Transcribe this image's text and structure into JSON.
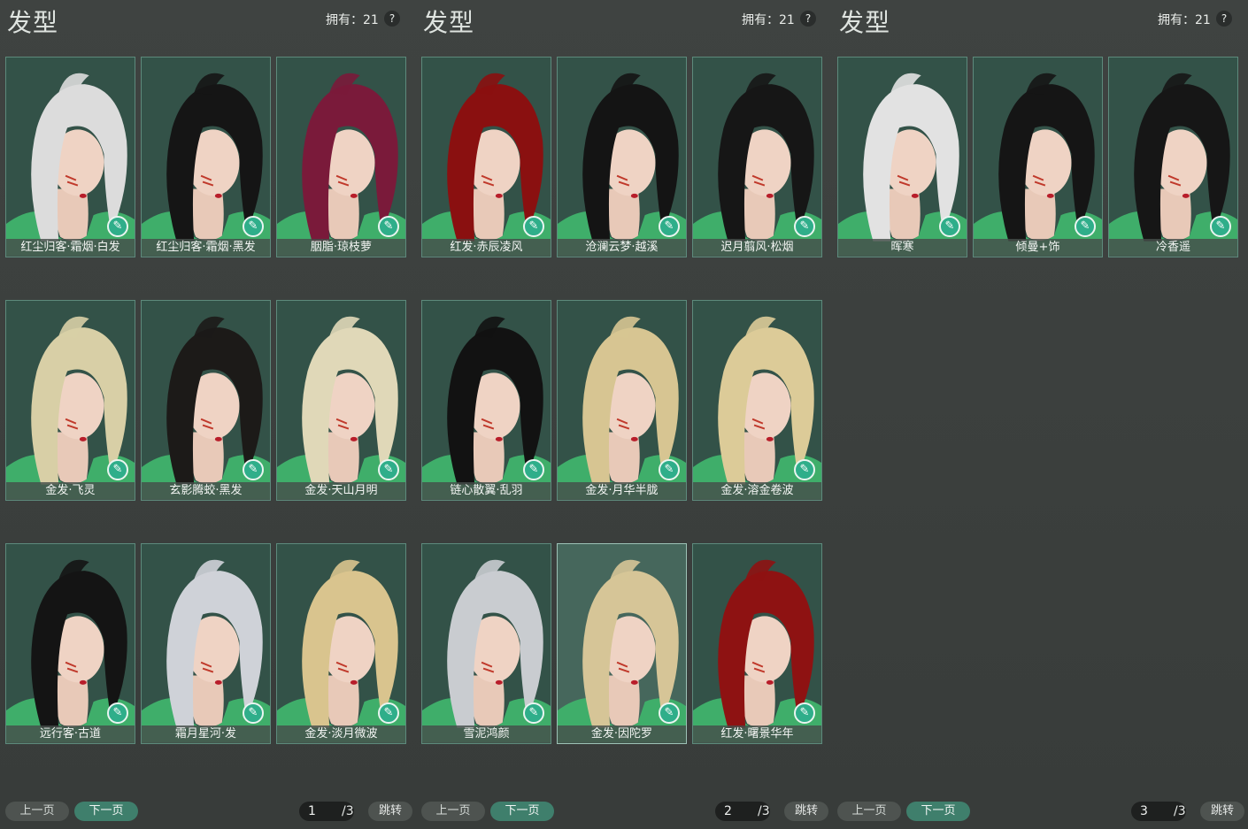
{
  "panels": [
    {
      "title": "发型",
      "owned": "拥有：21",
      "help": "?",
      "cards": [
        {
          "name": "红尘归客·霜烟·白发",
          "hair": "#dcdcdc"
        },
        {
          "name": "红尘归客·霜烟·黑发",
          "hair": "#151515"
        },
        {
          "name": "胭脂·琼枝萝",
          "hair": "#7a1a3a"
        },
        {
          "name": "金发·飞灵",
          "hair": "#d8cfa6"
        },
        {
          "name": "玄影腾蛟·黑发",
          "hair": "#1c1a18"
        },
        {
          "name": "金发·天山月明",
          "hair": "#e0d8b8"
        },
        {
          "name": "远行客·古道",
          "hair": "#141414"
        },
        {
          "name": "霜月星河·发",
          "hair": "#cfd2d8"
        },
        {
          "name": "金发·淡月微波",
          "hair": "#d9c48e"
        }
      ],
      "prev": "上一页",
      "next": "下一页",
      "page": "1",
      "total": "/3",
      "jump": "跳转"
    },
    {
      "title": "发型",
      "owned": "拥有：21",
      "help": "?",
      "cards": [
        {
          "name": "红发·赤辰凌风",
          "hair": "#8a1010"
        },
        {
          "name": "沧澜云梦·越溪",
          "hair": "#141414"
        },
        {
          "name": "迟月翦风·松烟",
          "hair": "#161616"
        },
        {
          "name": "链心散翼·乱羽",
          "hair": "#121212"
        },
        {
          "name": "金发·月华半胧",
          "hair": "#d7c592"
        },
        {
          "name": "金发·溶金卷波",
          "hair": "#dccb98"
        },
        {
          "name": "雪泥鸿颜",
          "hair": "#c9ccd0"
        },
        {
          "name": "金发·因陀罗",
          "hair": "#d6c597",
          "selected": true
        },
        {
          "name": "红发·曙景华年",
          "hair": "#8e1212"
        }
      ],
      "prev": "上一页",
      "next": "下一页",
      "page": "2",
      "total": "/3",
      "jump": "跳转"
    },
    {
      "title": "发型",
      "owned": "拥有：21",
      "help": "?",
      "cards": [
        {
          "name": "晖寒",
          "hair": "#e2e2e2"
        },
        {
          "name": "倾曼+饰",
          "hair": "#151515"
        },
        {
          "name": "冷香遥",
          "hair": "#161616"
        }
      ],
      "prev": "上一页",
      "next": "下一页",
      "page": "3",
      "total": "/3",
      "jump": "跳转"
    }
  ],
  "icons": {
    "dye": "brush-icon",
    "help": "question-icon"
  },
  "colors": {
    "card_bg": "#335248",
    "card_border": "#5d8a7c",
    "accent": "#3f7f6c",
    "dye_badge": "#2fae8a"
  }
}
